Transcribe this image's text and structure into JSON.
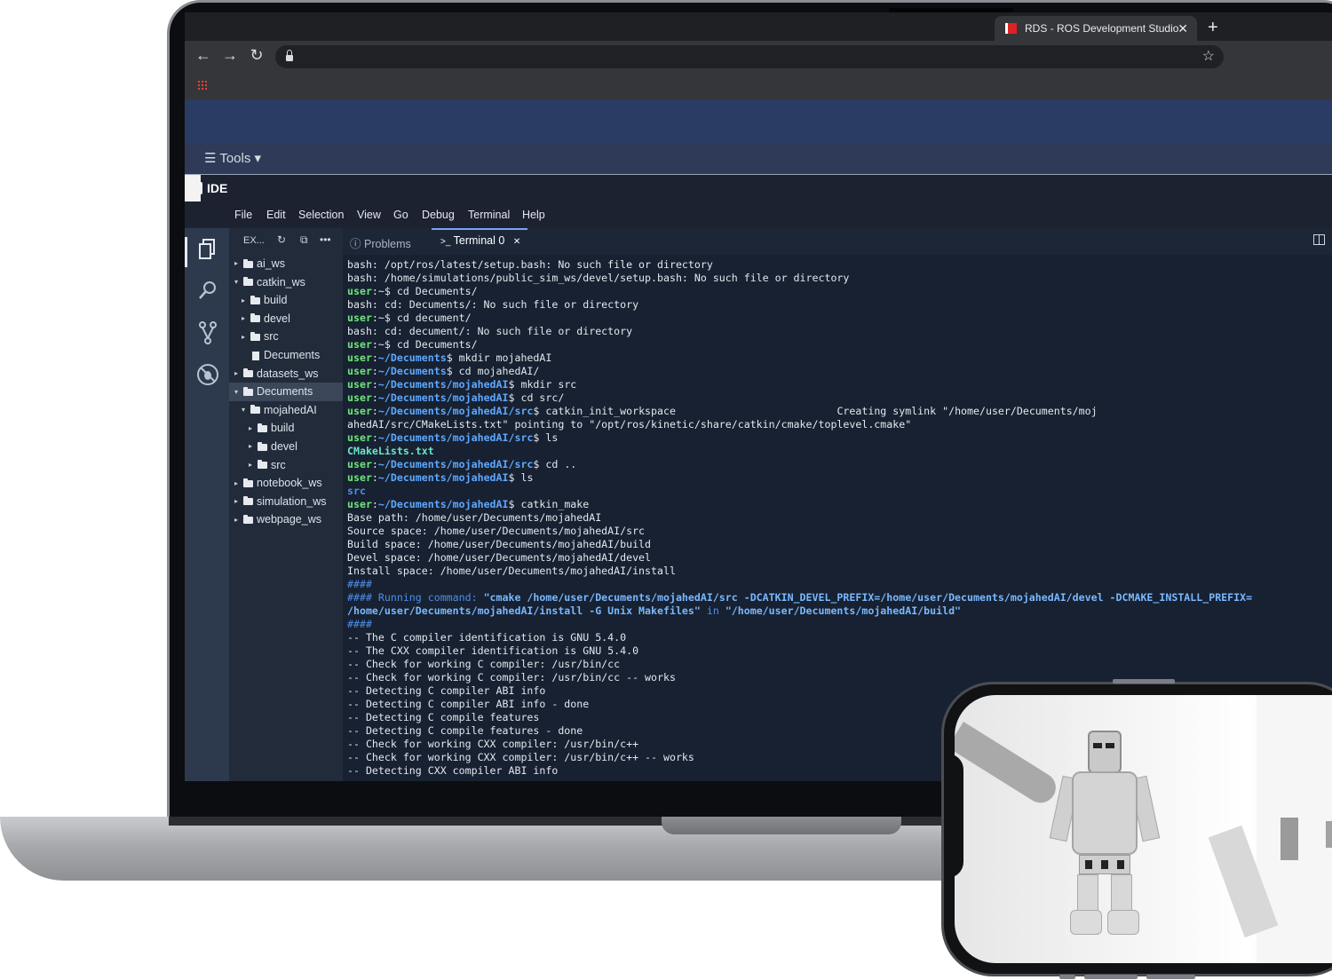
{
  "browser": {
    "tab_title": "RDS - ROS Development Studio",
    "tab_close": "✕",
    "new_tab": "+",
    "back": "←",
    "forward": "→",
    "reload": "↻",
    "star": "☆"
  },
  "toolbar": {
    "tools_label": "☰ Tools ▾"
  },
  "ide": {
    "title": "IDE",
    "menu": [
      "File",
      "Edit",
      "Selection",
      "View",
      "Go",
      "Debug",
      "Terminal",
      "Help"
    ]
  },
  "explorer": {
    "title": "EX...",
    "icons": {
      "refresh": "↻",
      "collapse": "⧉",
      "more": "•••"
    },
    "items": [
      {
        "label": "ai_ws",
        "depth": 0,
        "type": "folder",
        "caret": "▸"
      },
      {
        "label": "catkin_ws",
        "depth": 0,
        "type": "folder",
        "caret": "▾"
      },
      {
        "label": "build",
        "depth": 1,
        "type": "folder",
        "caret": "▸"
      },
      {
        "label": "devel",
        "depth": 1,
        "type": "folder",
        "caret": "▸"
      },
      {
        "label": "src",
        "depth": 1,
        "type": "folder",
        "caret": "▸"
      },
      {
        "label": "Decuments",
        "depth": 1,
        "type": "file",
        "caret": ""
      },
      {
        "label": "datasets_ws",
        "depth": 0,
        "type": "folder",
        "caret": "▸"
      },
      {
        "label": "Decuments",
        "depth": 0,
        "type": "folder",
        "caret": "▾",
        "selected": true
      },
      {
        "label": "mojahedAI",
        "depth": 1,
        "type": "folder",
        "caret": "▾"
      },
      {
        "label": "build",
        "depth": 2,
        "type": "folder",
        "caret": "▸"
      },
      {
        "label": "devel",
        "depth": 2,
        "type": "folder",
        "caret": "▸"
      },
      {
        "label": "src",
        "depth": 2,
        "type": "folder",
        "caret": "▸"
      },
      {
        "label": "notebook_ws",
        "depth": 0,
        "type": "folder",
        "caret": "▸"
      },
      {
        "label": "simulation_ws",
        "depth": 0,
        "type": "folder",
        "caret": "▸"
      },
      {
        "label": "webpage_ws",
        "depth": 0,
        "type": "folder",
        "caret": "▸"
      }
    ]
  },
  "panel": {
    "problems_label": "Problems",
    "terminal_label": "Terminal 0",
    "terminal_close": "✕",
    "problems_icon": "ⓘ",
    "terminal_icon": ">_"
  },
  "terminal": {
    "lines": [
      [
        {
          "t": "bash: /opt/ros/latest/setup.bash: No such file or directory"
        }
      ],
      [
        {
          "t": "bash: /home/simulations/public_sim_ws/devel/setup.bash: No such file or directory"
        }
      ],
      [
        {
          "t": "user",
          "c": "t-user"
        },
        {
          "t": ":~$ cd Decuments/"
        }
      ],
      [
        {
          "t": "bash: cd: Decuments/: No such file or directory"
        }
      ],
      [
        {
          "t": "user",
          "c": "t-user"
        },
        {
          "t": ":~$ cd decument/"
        }
      ],
      [
        {
          "t": "bash: cd: decument/: No such file or directory"
        }
      ],
      [
        {
          "t": "user",
          "c": "t-user"
        },
        {
          "t": ":~$ cd Decuments/"
        }
      ],
      [
        {
          "t": "user",
          "c": "t-user"
        },
        {
          "t": ":"
        },
        {
          "t": "~/Decuments",
          "c": "t-path"
        },
        {
          "t": "$ mkdir mojahedAI"
        }
      ],
      [
        {
          "t": "user",
          "c": "t-user"
        },
        {
          "t": ":"
        },
        {
          "t": "~/Decuments",
          "c": "t-path"
        },
        {
          "t": "$ cd mojahedAI/"
        }
      ],
      [
        {
          "t": "user",
          "c": "t-user"
        },
        {
          "t": ":"
        },
        {
          "t": "~/Decuments/mojahedAI",
          "c": "t-path"
        },
        {
          "t": "$ mkdir src"
        }
      ],
      [
        {
          "t": "user",
          "c": "t-user"
        },
        {
          "t": ":"
        },
        {
          "t": "~/Decuments/mojahedAI",
          "c": "t-path"
        },
        {
          "t": "$ cd src/"
        }
      ],
      [
        {
          "t": "user",
          "c": "t-user"
        },
        {
          "t": ":"
        },
        {
          "t": "~/Decuments/mojahedAI/src",
          "c": "t-path"
        },
        {
          "t": "$ catkin_init_workspace                          Creating symlink \"/home/user/Decuments/moj"
        }
      ],
      [
        {
          "t": "ahedAI/src/CMakeLists.txt\" pointing to \"/opt/ros/kinetic/share/catkin/cmake/toplevel.cmake\""
        }
      ],
      [
        {
          "t": "user",
          "c": "t-user"
        },
        {
          "t": ":"
        },
        {
          "t": "~/Decuments/mojahedAI/src",
          "c": "t-path"
        },
        {
          "t": "$ ls"
        }
      ],
      [
        {
          "t": "CMakeLists.txt",
          "c": "t-file"
        }
      ],
      [
        {
          "t": "user",
          "c": "t-user"
        },
        {
          "t": ":"
        },
        {
          "t": "~/Decuments/mojahedAI/src",
          "c": "t-path"
        },
        {
          "t": "$ cd .."
        }
      ],
      [
        {
          "t": "user",
          "c": "t-user"
        },
        {
          "t": ":"
        },
        {
          "t": "~/Decuments/mojahedAI",
          "c": "t-path"
        },
        {
          "t": "$ ls"
        }
      ],
      [
        {
          "t": "src",
          "c": "t-dir"
        }
      ],
      [
        {
          "t": "user",
          "c": "t-user"
        },
        {
          "t": ":"
        },
        {
          "t": "~/Decuments/mojahedAI",
          "c": "t-path"
        },
        {
          "t": "$ catkin_make"
        }
      ],
      [
        {
          "t": "Base path: /home/user/Decuments/mojahedAI"
        }
      ],
      [
        {
          "t": "Source space: /home/user/Decuments/mojahedAI/src"
        }
      ],
      [
        {
          "t": "Build space: /home/user/Decuments/mojahedAI/build"
        }
      ],
      [
        {
          "t": "Devel space: /home/user/Decuments/mojahedAI/devel"
        }
      ],
      [
        {
          "t": "Install space: /home/user/Decuments/mojahedAI/install"
        }
      ],
      [
        {
          "t": "####",
          "c": "t-cm"
        }
      ],
      [
        {
          "t": "#### Running command: ",
          "c": "t-cm"
        },
        {
          "t": "\"cmake /home/user/Decuments/mojahedAI/src -DCATKIN_DEVEL_PREFIX=/home/user/Decuments/mojahedAI/devel -DCMAKE_INSTALL_PREFIX=",
          "c": "t-cmb"
        }
      ],
      [
        {
          "t": "/home/user/Decuments/mojahedAI/install -G Unix Makefiles\"",
          "c": "t-cmb"
        },
        {
          "t": " in ",
          "c": "t-cm"
        },
        {
          "t": "\"/home/user/Decuments/mojahedAI/build\"",
          "c": "t-cmb"
        }
      ],
      [
        {
          "t": "####",
          "c": "t-cm"
        }
      ],
      [
        {
          "t": "-- The C compiler identification is GNU 5.4.0"
        }
      ],
      [
        {
          "t": "-- The CXX compiler identification is GNU 5.4.0"
        }
      ],
      [
        {
          "t": "-- Check for working C compiler: /usr/bin/cc"
        }
      ],
      [
        {
          "t": "-- Check for working C compiler: /usr/bin/cc -- works"
        }
      ],
      [
        {
          "t": "-- Detecting C compiler ABI info"
        }
      ],
      [
        {
          "t": "-- Detecting C compiler ABI info - done"
        }
      ],
      [
        {
          "t": "-- Detecting C compile features"
        }
      ],
      [
        {
          "t": "-- Detecting C compile features - done"
        }
      ],
      [
        {
          "t": "-- Check for working CXX compiler: /usr/bin/c++"
        }
      ],
      [
        {
          "t": "-- Check for working CXX compiler: /usr/bin/c++ -- works"
        }
      ],
      [
        {
          "t": "-- Detecting CXX compiler ABI info"
        }
      ]
    ]
  }
}
